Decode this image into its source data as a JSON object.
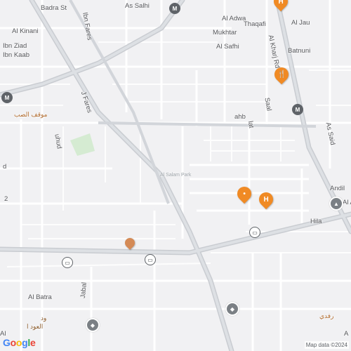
{
  "map": {
    "street_labels": {
      "badra_st": "Badra St",
      "as_salhi": "As Salhi",
      "al_adwa": "Al Adwa",
      "thaqafi": "Thaqafi",
      "mukhtar": "Mukhtar",
      "al_jau": "Al Jau",
      "al_kinani": "Al Kinani",
      "ibn_fares": "Ibn Fares",
      "al_kharj_rd": "Al Kharj Rd",
      "al_safhi": "Al Safhi",
      "batnuni": "Batnuni",
      "bin_ziad": "Ibn Ziad",
      "ibn_kaab": "Ibn Kaab",
      "j_fares": "J Fares",
      "ahb": "ahb",
      "saal": "Saal",
      "lat": "lat",
      "ar_station": "موقف الصب",
      "uhud": "uhud",
      "as_said": "As Said",
      "andil": "Andil",
      "hila": "Hila",
      "al_batra": "Al Batra",
      "jabal": "Jabal",
      "ar_alawd": "العود ا",
      "ar_ud": "ود",
      "ar_right": "رفدي",
      "al_a": "Al A",
      "a_edge": "A",
      "al_edge": "Al",
      "h_edge": "d",
      "amp": "2"
    },
    "poi_faded": "Al Salam Park",
    "pins": {
      "top_right": "H",
      "kharj": "fork-knife-icon",
      "center": "",
      "center_h": "H"
    },
    "footer": {
      "google": "Google",
      "attribution": "Map data ©2024"
    },
    "colors": {
      "pin_orange": "#f08a24",
      "park_green": "#d4ecd2",
      "road_main": "#c8ccd2",
      "road_minor": "#ffffff"
    }
  }
}
